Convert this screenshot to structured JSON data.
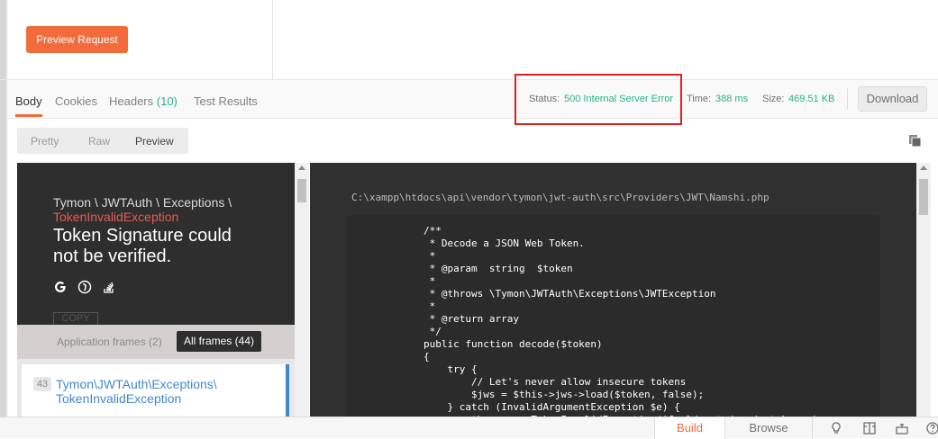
{
  "request": {
    "preview_button": "Preview Request"
  },
  "response": {
    "tabs": {
      "body": "Body",
      "cookies": "Cookies",
      "headers": "Headers",
      "headers_count": "(10)",
      "tests": "Test Results"
    },
    "status_label": "Status:",
    "status_value": "500 Internal Server Error",
    "time_label": "Time:",
    "time_value": "388 ms",
    "size_label": "Size:",
    "size_value": "469.51 KB",
    "download": "Download",
    "view_modes": {
      "pretty": "Pretty",
      "raw": "Raw",
      "preview": "Preview"
    }
  },
  "error_page": {
    "namespace": "Tymon \\ JWTAuth \\ Exceptions \\",
    "exception_class": "TokenInvalidException",
    "message": "Token Signature could not be verified.",
    "icons": [
      "google-icon",
      "duckduckgo-icon",
      "stackoverflow-icon"
    ],
    "copy_label": "COPY",
    "app_frames": "Application frames (2)",
    "all_frames": "All frames (44)",
    "frame_number": "43",
    "frame_name": "Tymon\\JWTAuth\\Exceptions\\ TokenInvalidException",
    "file_path": "C:\\xampp\\htdocs\\api\\vendor\\tymon\\jwt-auth\\src\\Providers\\JWT\\Namshi.php",
    "code": "/**\n * Decode a JSON Web Token.\n *\n * @param  string  $token\n *\n * @throws \\Tymon\\JWTAuth\\Exceptions\\JWTException\n *\n * @return array\n */\npublic function decode($token)\n{\n    try {\n        // Let's never allow insecure tokens\n        $jws = $this->jws->load($token, false);\n    } catch (InvalidArgumentException $e) {\n        throw new TokenInvalidException('Could not decode token: '."
  },
  "footer": {
    "build": "Build",
    "browse": "Browse"
  },
  "colors": {
    "accent": "#f26b3a",
    "success": "#26b47f",
    "highlight_border": "#e01f1f",
    "frame_link": "#4288ce",
    "exception_red": "#e55b54"
  }
}
